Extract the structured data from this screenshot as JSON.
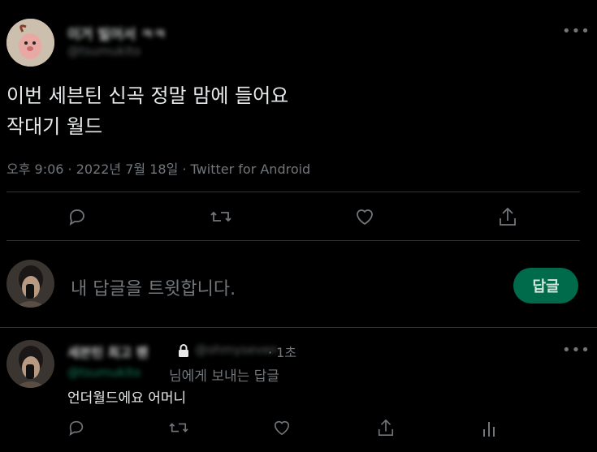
{
  "tweet": {
    "author_name": "이거 빌어서 ㅋㅋ",
    "author_handle": "@tsumukito",
    "text_line1": "이번 세븐틴 신곡 정말 맘에 들어요",
    "text_line2": "작대기 월드",
    "meta": "오후 9:06 · 2022년 7월 18일 · Twitter for Android"
  },
  "compose": {
    "placeholder": "내 답글을 트윗합니다.",
    "reply_button": "답글"
  },
  "reply": {
    "author_name": "세븐틴 최고 팬",
    "author_handle": "@ohmyseven",
    "time": "· 1초",
    "replying_to_handle": "@tsumukito",
    "replying_to_suffix": "님에게 보내는 답글",
    "text": "언더월드에요 어머니"
  },
  "icons": [
    "reply-icon",
    "retweet-icon",
    "like-icon",
    "share-icon",
    "analytics-icon",
    "lock-icon",
    "more-icon"
  ]
}
